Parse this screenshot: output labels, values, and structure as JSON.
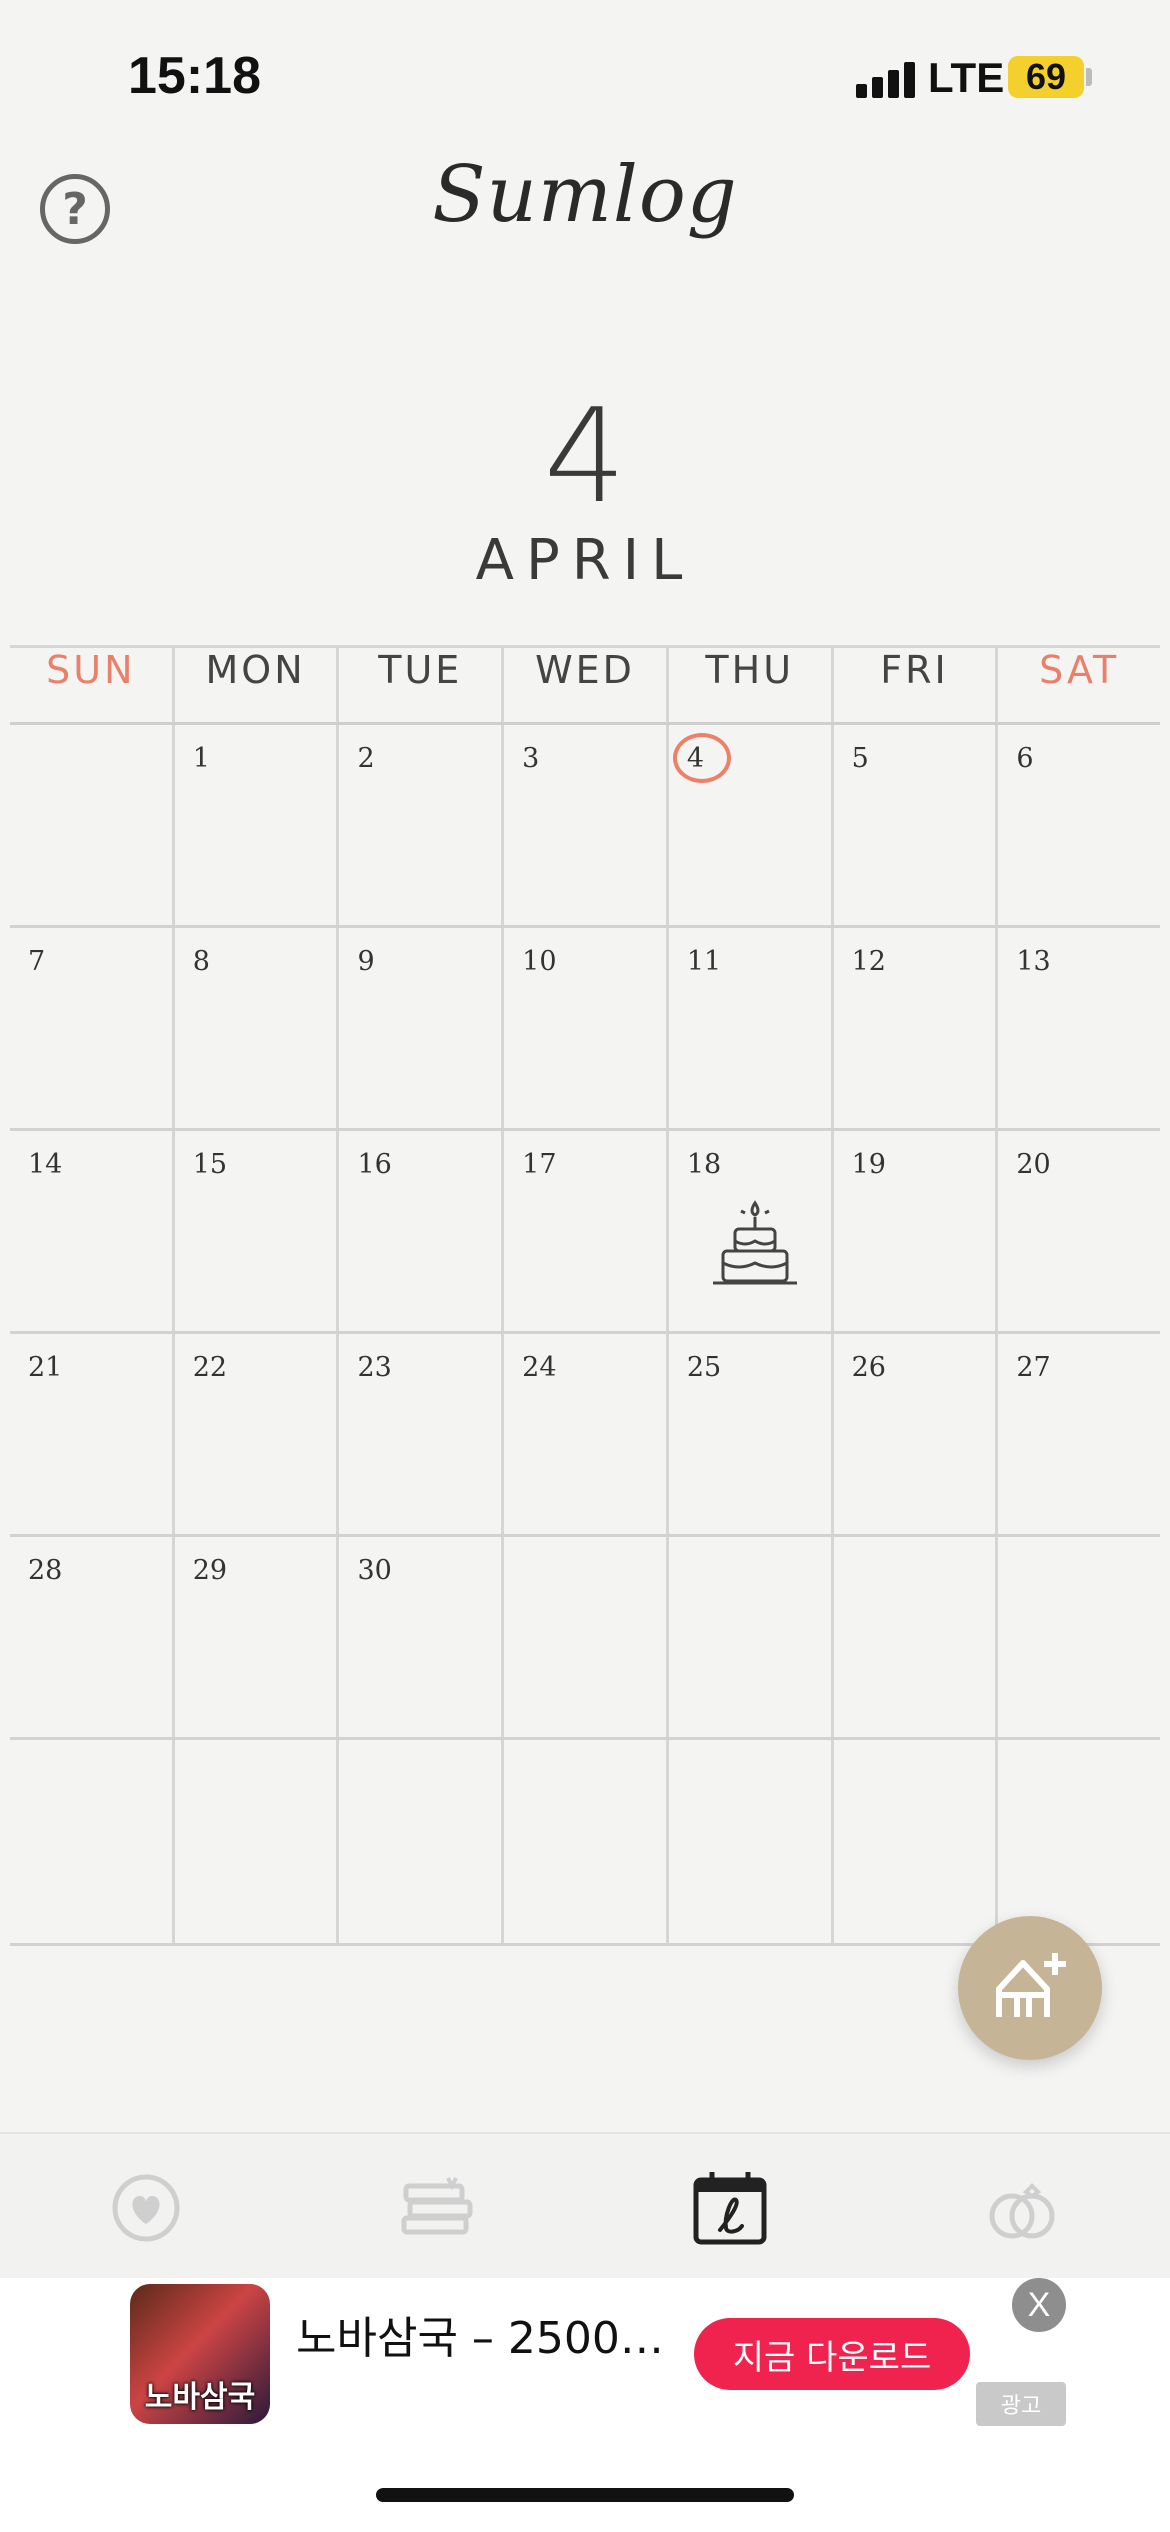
{
  "status_bar": {
    "time": "15:18",
    "network": "LTE",
    "battery": "69"
  },
  "header": {
    "app_title": "Sumlog",
    "help_icon": "question-circle-icon"
  },
  "month": {
    "number": "4",
    "name": "APRIL"
  },
  "calendar": {
    "weekdays": [
      "SUN",
      "MON",
      "TUE",
      "WED",
      "THU",
      "FRI",
      "SAT"
    ],
    "weekend_color": "#e8806a",
    "today": "4",
    "today_color": "#ec8068",
    "weeks": [
      [
        "",
        "1",
        "2",
        "3",
        "4",
        "5",
        "6"
      ],
      [
        "7",
        "8",
        "9",
        "10",
        "11",
        "12",
        "13"
      ],
      [
        "14",
        "15",
        "16",
        "17",
        "18",
        "19",
        "20"
      ],
      [
        "21",
        "22",
        "23",
        "24",
        "25",
        "26",
        "27"
      ],
      [
        "28",
        "29",
        "30",
        "",
        "",
        "",
        ""
      ],
      [
        "",
        "",
        "",
        "",
        "",
        "",
        ""
      ]
    ],
    "event_icon": {
      "day": "18",
      "icon": "birthday-cake-icon"
    }
  },
  "fab": {
    "icon": "add-anniversary-icon",
    "color": "#c5b596"
  },
  "bottom_nav": {
    "items": [
      {
        "icon": "heart-icon",
        "active": false
      },
      {
        "icon": "books-icon",
        "active": false
      },
      {
        "icon": "calendar-icon",
        "active": true
      },
      {
        "icon": "rings-icon",
        "active": false
      }
    ]
  },
  "ad": {
    "thumb_text": "노바삼국",
    "title": "노바삼국 – 2500…",
    "cta": "지금 다운로드",
    "close": "X",
    "label": "광고",
    "cta_color": "#f0234f"
  }
}
